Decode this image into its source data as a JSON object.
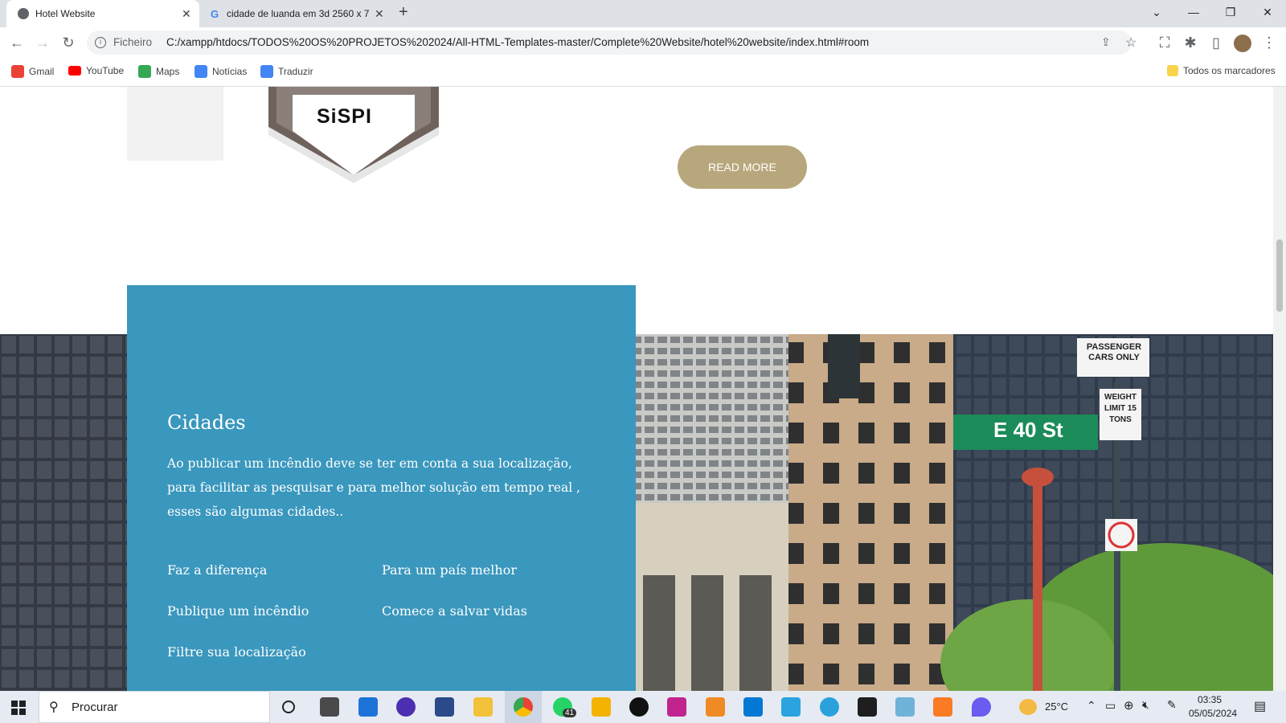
{
  "tabs": [
    {
      "title": "Hotel Website",
      "active": true
    },
    {
      "title": "cidade de luanda em 3d 2560 x 7",
      "active": false
    }
  ],
  "address": {
    "scheme_label": "Ficheiro",
    "url": "C:/xampp/htdocs/TODOS%20OS%20PROJETOS%202024/All-HTML-Templates-master/Complete%20Website/hotel%20website/index.html#room"
  },
  "bookmarks": [
    {
      "label": "Gmail",
      "color": "#ea4335"
    },
    {
      "label": "YouTube",
      "color": "#ff0000"
    },
    {
      "label": "Maps",
      "color": "#34a853"
    },
    {
      "label": "Notícias",
      "color": "#4285f4"
    },
    {
      "label": "Traduzir",
      "color": "#4285f4"
    }
  ],
  "bookmarks_folder": "Todos os marcadores",
  "page": {
    "logo_text": "SiSPI",
    "read_more": "READ MORE",
    "section_title": "Cidades",
    "section_text": "Ao publicar um incêndio deve se ter em conta a sua localização, para facilitar as pesquisar e para melhor solução em tempo real , esses são algumas cidades..",
    "links": [
      "Faz a diferença",
      "Para um país melhor",
      "Publique um incêndio",
      "Comece a salvar vidas",
      "Filtre sua localização"
    ],
    "street_sign": "E 40 St",
    "sign_passenger": "PASSENGER CARS ONLY",
    "sign_weight": "WEIGHT LIMIT 15 TONS"
  },
  "taskbar": {
    "search_placeholder": "Procurar",
    "weather": "25°C",
    "time": "03:35",
    "date": "05/05/2024",
    "whatsapp_badge": "41"
  },
  "colors": {
    "accent_blue": "#3a97bd",
    "button_gold": "#b8a77c"
  }
}
